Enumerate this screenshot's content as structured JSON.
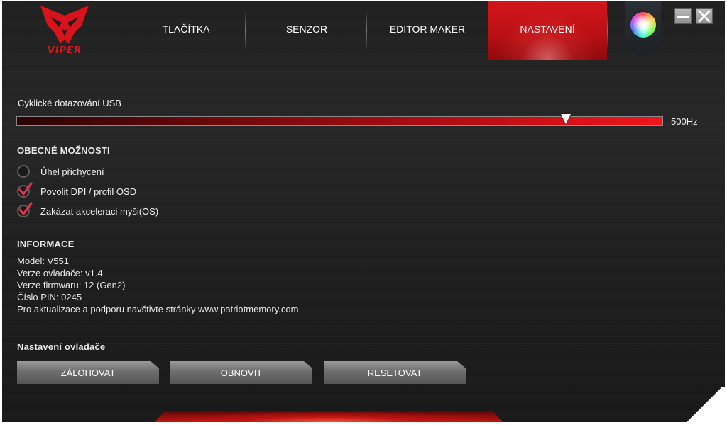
{
  "app": {
    "brand": "VIPER"
  },
  "tabs": [
    {
      "label": "TLAČÍTKA",
      "active": false
    },
    {
      "label": "SENZOR",
      "active": false
    },
    {
      "label": "EDITOR MAKER",
      "active": false
    },
    {
      "label": "NASTAVENÍ",
      "active": true
    }
  ],
  "window_controls": {
    "minimize_icon": "minus-icon",
    "close_icon": "x-icon"
  },
  "color_tab_icon": "color-wheel-icon",
  "usb": {
    "label": "Cyklické dotazování USB",
    "value": "500Hz",
    "level_fraction": 0.85
  },
  "general": {
    "title": "OBECNÉ MOŽNOSTI",
    "options": [
      {
        "label": "Úhel přichycení",
        "checked": false
      },
      {
        "label": "Povolit DPI / profil OSD",
        "checked": true
      },
      {
        "label": "Zakázat akceleraci myši(OS)",
        "checked": true
      }
    ]
  },
  "info": {
    "title": "INFORMACE",
    "lines": [
      "Model: V551",
      "Verze ovladače: v1.4",
      "Verze firmwaru: 12 (Gen2)",
      "Číslo PIN: 0245",
      "Pro aktualizace a podporu navštivte stránky www.patriotmemory.com"
    ]
  },
  "driver": {
    "title": "Nastavení ovladače",
    "buttons": [
      "ZÁLOHOVAT",
      "OBNOVIT",
      "RESETOVAT"
    ]
  },
  "colors": {
    "accent": "#d3151b",
    "background": "#222222",
    "check": "#e0304a"
  }
}
